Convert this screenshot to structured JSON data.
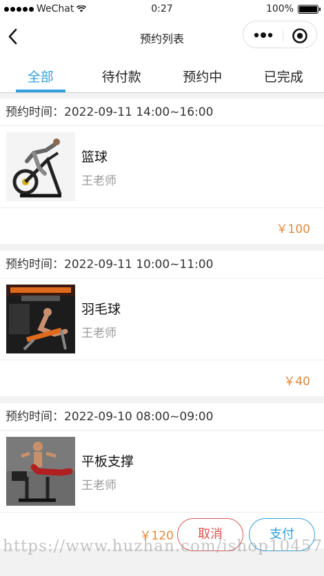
{
  "status_bar": {
    "carrier": "WeChat",
    "time": "0:27",
    "battery": "100%"
  },
  "nav": {
    "title": "预约列表"
  },
  "tabs": [
    {
      "label": "全部",
      "active": true
    },
    {
      "label": "待付款",
      "active": false
    },
    {
      "label": "预约中",
      "active": false
    },
    {
      "label": "已完成",
      "active": false
    }
  ],
  "orders": [
    {
      "time": "预约时间：2022-09-11 14:00~16:00",
      "name": "篮球",
      "teacher": "王老师",
      "price": "￥100"
    },
    {
      "time": "预约时间：2022-09-11 10:00~11:00",
      "name": "羽毛球",
      "teacher": "王老师",
      "price": "￥40"
    },
    {
      "time": "预约时间：2022-09-10 08:00~09:00",
      "name": "平板支撑",
      "teacher": "王老师",
      "price": "￥120",
      "actions": {
        "cancel": "取消",
        "pay": "支付"
      }
    }
  ],
  "watermark": "https://www.huzhan.com/ishop10457",
  "colors": {
    "accent": "#2fa0dc",
    "price": "#e3873a",
    "cancel": "#d9534f"
  }
}
